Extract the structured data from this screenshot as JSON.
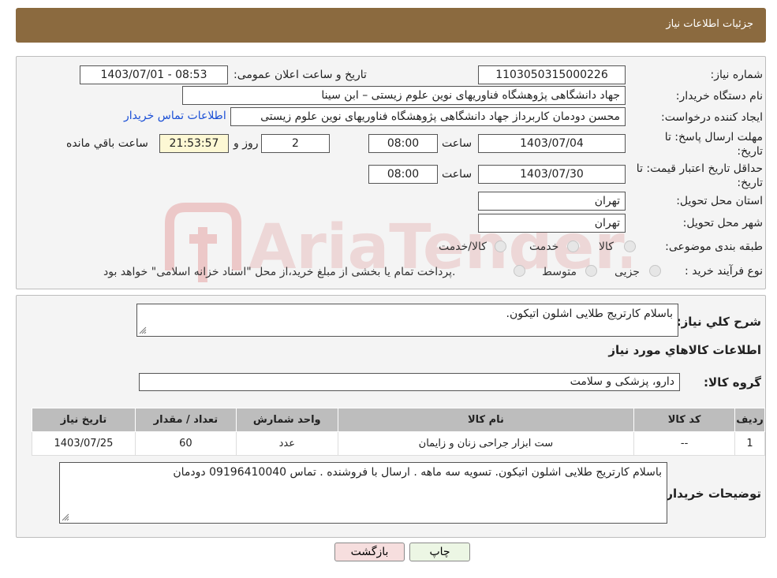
{
  "header": {
    "title": "جزئیات اطلاعات نیاز"
  },
  "form": {
    "need_number_label": "شماره نیاز:",
    "need_number": "1103050315000226",
    "announce_label": "تاریخ و ساعت اعلان عمومی:",
    "announce_value": "1403/07/01 - 08:53",
    "buyer_label": "نام دستگاه خریدار:",
    "buyer_value": "جهاد دانشگاهی پژوهشگاه فناوریهای نوین علوم زیستی – ابن سینا",
    "creator_label": "ایجاد کننده درخواست:",
    "creator_value": "محسن دودمان کاربرداز جهاد دانشگاهی پژوهشگاه فناوریهای نوین علوم زیستی",
    "contact_link": "اطلاعات تماس خریدار",
    "deadline_label_1": "مهلت ارسال پاسخ: تا",
    "deadline_label_2": "تاریخ:",
    "deadline_date": "1403/07/04",
    "time_label": "ساعت",
    "deadline_time": "08:00",
    "days_value": "2",
    "days_label": "روز و",
    "remaining_time": "21:53:57",
    "remaining_label": "ساعت باقي مانده",
    "validity_label_1": "حداقل تاریخ اعتبار قیمت: تا",
    "validity_label_2": "تاریخ:",
    "validity_date": "1403/07/30",
    "validity_time": "08:00",
    "province_label": "استان محل تحویل:",
    "province_value": "تهران",
    "city_label": "شهر محل تحویل:",
    "city_value": "تهران",
    "category_label": "طبقه بندی موضوعی:",
    "cat_goods": "کالا",
    "cat_service": "خدمت",
    "cat_goods_service": "کالا/خدمت",
    "process_label": "نوع فرآیند خرید :",
    "proc_partial": "جزیی",
    "proc_medium": "متوسط",
    "proc_note": "پرداخت تمام یا بخشی از مبلغ خرید،از محل \"اسناد خزانه اسلامی\" خواهد بود."
  },
  "details": {
    "description_label": "شرح کلي نياز:",
    "description_value": "باسلام کارتریج طلایی  اشلون اتیکون.",
    "goods_info_title": "اطلاعات کالاهاي مورد نياز",
    "group_label": "گروه کالا:",
    "group_value": "دارو، پزشکی و سلامت",
    "table_headers": [
      "ردیف",
      "کد کالا",
      "نام کالا",
      "واحد شمارش",
      "تعداد / مقدار",
      "تاریخ نیاز"
    ],
    "table_rows": [
      [
        "1",
        "--",
        "ست ابزار جراحی زنان و زایمان",
        "عدد",
        "60",
        "1403/07/25"
      ]
    ],
    "buyer_notes_label": "توضیحات خریدار:",
    "buyer_notes_value": "باسلام کارتریج طلایی  اشلون اتیکون. تسویه سه ماهه . ارسال با فروشنده . تماس 09196410040 دودمان"
  },
  "buttons": {
    "print": "چاپ",
    "back": "بازگشت"
  },
  "watermark": {
    "text": "AriaTender.neT"
  },
  "colors": {
    "header_bg": "#8b6a3f",
    "link": "#1a4fd6",
    "back_btn_bg": "#f6dede",
    "print_btn_bg": "#ecf6e4"
  }
}
